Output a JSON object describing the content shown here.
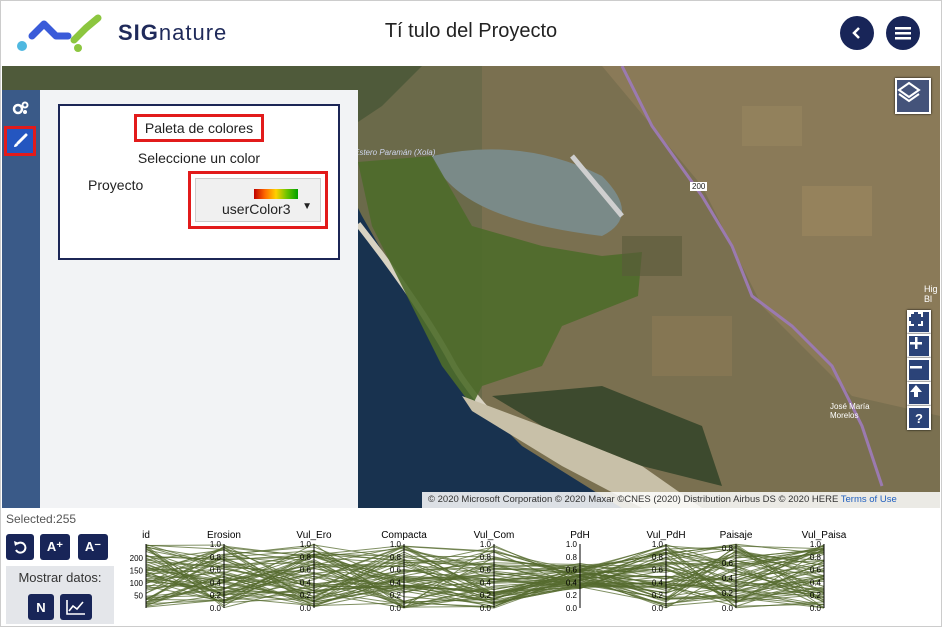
{
  "header": {
    "logo_text_bold": "SIG",
    "logo_text_rest": "nature",
    "title": "Tí tulo del Proyecto",
    "back_icon": "chevron-left-icon",
    "menu_icon": "hamburger-icon",
    "accent_color": "#182558"
  },
  "map": {
    "labels": [
      "Estero Paramán (Xola)",
      "José María Morelos",
      "200"
    ],
    "edge_label": "Hig Bl",
    "attribution": "© 2020 Microsoft Corporation © 2020 Maxar ©CNES (2020) Distribution Airbus DS © 2020 HERE",
    "terms": "Terms of Use",
    "controls": [
      "layers-icon",
      "fullscreen-icon",
      "zoom-in-icon",
      "zoom-out-icon",
      "reset-north-icon",
      "help-icon"
    ]
  },
  "sidebar": {
    "tabs": [
      {
        "icon": "gears-icon",
        "selected": false
      },
      {
        "icon": "brush-icon",
        "selected": true
      }
    ]
  },
  "palette": {
    "title": "Paleta de colores",
    "prompt": "Seleccione un color",
    "project_label": "Proyecto",
    "selected_color": "userColor3",
    "highlight_color": "#e21b1b"
  },
  "bottom": {
    "selected_text": "Selected:255",
    "reset_icon": "undo-icon",
    "font_increase": "A⁺",
    "font_decrease": "A⁻",
    "show_data_label": "Mostrar datos:",
    "n_button": "N",
    "chart_icon": "line-chart-icon"
  },
  "chart_data": {
    "type": "parallel-coordinates",
    "axes": [
      "id",
      "Erosion",
      "Vul_Ero",
      "Compacta",
      "Vul_Com",
      "PdH",
      "Vul_PdH",
      "Paisaje",
      "Vul_Paisa"
    ],
    "axis_ranges": [
      [
        0,
        255
      ],
      [
        0,
        1
      ],
      [
        0,
        1
      ],
      [
        0,
        1
      ],
      [
        0,
        1
      ],
      [
        0,
        1
      ],
      [
        0,
        1
      ],
      [
        0,
        0.8
      ],
      [
        0,
        1
      ]
    ],
    "id_ticks": [
      "200",
      "150",
      "100",
      "50"
    ],
    "unit_ticks": [
      "1.0",
      "0.8",
      "0.6",
      "0.4",
      "0.2",
      "0.0"
    ],
    "paisaje_ticks": [
      "0.8",
      "0.6",
      "0.4",
      "0.2",
      "0.0"
    ],
    "line_color": "#556b2f",
    "selected_count": 255
  }
}
